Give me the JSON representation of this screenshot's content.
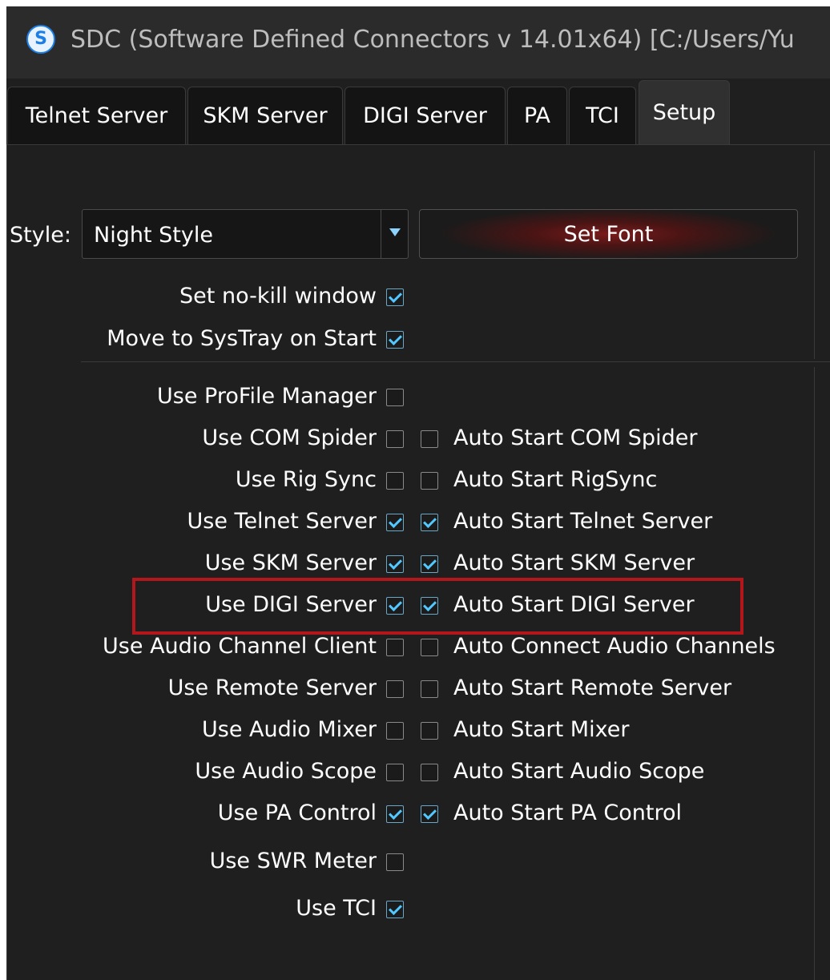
{
  "window": {
    "title": "SDC (Software Defined Connectors v 14.01x64) [C:/Users/Yu",
    "app_icon_glyph": "S"
  },
  "tabs": [
    {
      "label": "Telnet Server",
      "active": false
    },
    {
      "label": "SKM Server",
      "active": false
    },
    {
      "label": "DIGI Server",
      "active": false
    },
    {
      "label": "PA",
      "active": false
    },
    {
      "label": "TCI",
      "active": false
    },
    {
      "label": "Setup",
      "active": true
    }
  ],
  "setup": {
    "style_label": "Style:",
    "style_value": "Night Style",
    "set_font_label": "Set Font",
    "no_kill_label": "Set no-kill window",
    "no_kill_checked": true,
    "systray_label": "Move to SysTray on Start",
    "systray_checked": true,
    "options": [
      {
        "label": "Use ProFile Manager",
        "checked": false,
        "auto_label": null,
        "auto_checked": null
      },
      {
        "label": "Use COM Spider",
        "checked": false,
        "auto_label": "Auto Start COM Spider",
        "auto_checked": false
      },
      {
        "label": "Use Rig Sync",
        "checked": false,
        "auto_label": "Auto Start RigSync",
        "auto_checked": false
      },
      {
        "label": "Use Telnet Server",
        "checked": true,
        "auto_label": "Auto Start Telnet Server",
        "auto_checked": true
      },
      {
        "label": "Use SKM Server",
        "checked": true,
        "auto_label": "Auto Start SKM Server",
        "auto_checked": true
      },
      {
        "label": "Use DIGI Server",
        "checked": true,
        "auto_label": "Auto Start DIGI Server",
        "auto_checked": true
      },
      {
        "label": "Use Audio Channel Client",
        "checked": false,
        "auto_label": "Auto Connect Audio Channels",
        "auto_checked": false
      },
      {
        "label": "Use Remote Server",
        "checked": false,
        "auto_label": "Auto Start Remote Server",
        "auto_checked": false
      },
      {
        "label": "Use Audio Mixer",
        "checked": false,
        "auto_label": "Auto Start Mixer",
        "auto_checked": false
      },
      {
        "label": "Use Audio Scope",
        "checked": false,
        "auto_label": "Auto Start Audio Scope",
        "auto_checked": false
      },
      {
        "label": "Use PA Control",
        "checked": true,
        "auto_label": "Auto Start PA Control",
        "auto_checked": true
      },
      {
        "label": "Use SWR Meter",
        "checked": false,
        "auto_label": null,
        "auto_checked": null
      },
      {
        "label": "Use TCI",
        "checked": true,
        "auto_label": null,
        "auto_checked": null
      }
    ]
  },
  "colors": {
    "background": "#1f1f1f",
    "checkmark": "#52c8ff",
    "highlight": "#b3171b",
    "set_font_glow": "#7a1b1b"
  }
}
